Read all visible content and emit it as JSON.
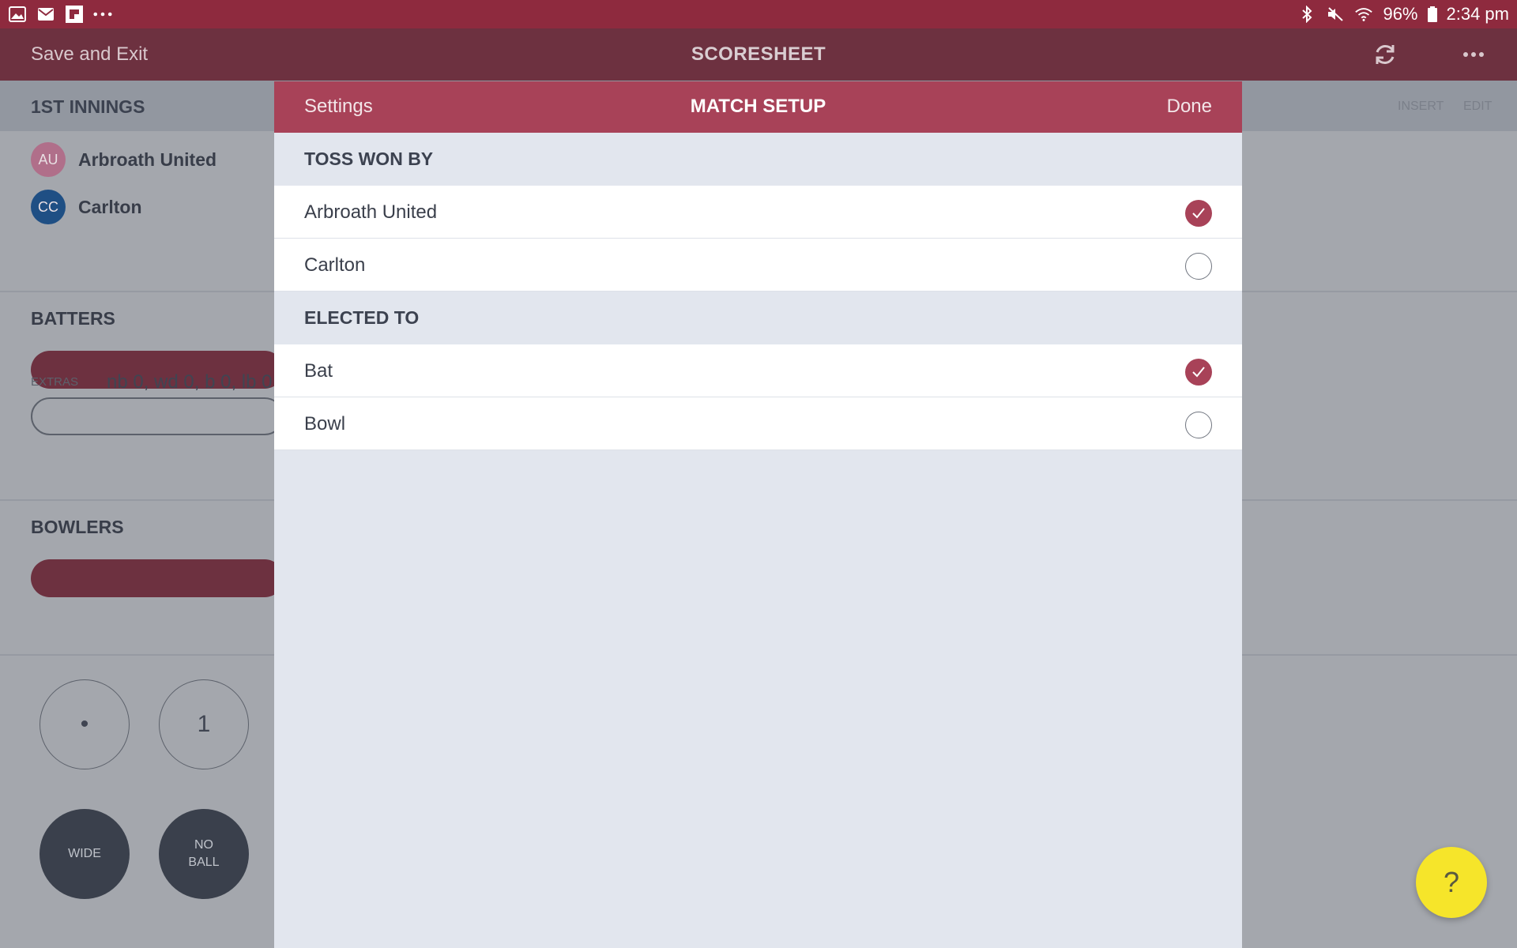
{
  "status_bar": {
    "battery": "96%",
    "time": "2:34 pm"
  },
  "app_bar": {
    "save_exit": "Save and Exit",
    "title": "SCORESHEET"
  },
  "background": {
    "innings_title": "1ST INNINGS",
    "insert": "INSERT",
    "edit": "EDIT",
    "teams": [
      {
        "initials": "AU",
        "name": "Arbroath United",
        "color": "#b06f8a"
      },
      {
        "initials": "CC",
        "name": "Carlton",
        "color": "#1f4f84"
      }
    ],
    "batters_label": "BATTERS",
    "extras_label": "EXTRAS",
    "extras_value": "nb 0, wd 0, b 0, lb 0",
    "bowlers_label": "BOWLERS",
    "buttons": {
      "dot": "•",
      "one": "1",
      "wide": "WIDE",
      "no_ball_line1": "NO",
      "no_ball_line2": "BALL"
    }
  },
  "modal": {
    "settings": "Settings",
    "title": "MATCH SETUP",
    "done": "Done",
    "toss_heading": "TOSS WON BY",
    "toss_options": [
      {
        "label": "Arbroath United",
        "selected": true
      },
      {
        "label": "Carlton",
        "selected": false
      }
    ],
    "elected_heading": "ELECTED TO",
    "elected_options": [
      {
        "label": "Bat",
        "selected": true
      },
      {
        "label": "Bowl",
        "selected": false
      }
    ]
  },
  "help": {
    "label": "?"
  },
  "colors": {
    "status_bar": "#8e2a3e",
    "app_bar": "#6d3140",
    "modal_header": "#a84258",
    "accent": "#a84258",
    "fab": "#f6e52a"
  }
}
